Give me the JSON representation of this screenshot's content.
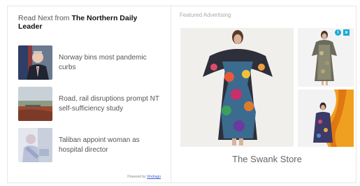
{
  "recirculation": {
    "header_prefix": "Read Next from ",
    "header_brand": "The Northern Daily Leader",
    "articles": [
      {
        "title": "Norway bins most pandemic curbs",
        "thumb_icon": "news-photo-politician"
      },
      {
        "title": "Road, rail disruptions prompt NT self-sufficiency study",
        "thumb_icon": "news-photo-landscape"
      },
      {
        "title": "Taliban appoint woman as hospital director",
        "thumb_icon": "news-photo-hospital"
      }
    ],
    "powered_prefix": "Powered by ",
    "powered_link": "Vindrago"
  },
  "ad": {
    "label": "Featured Advertising",
    "info_icon": "info-icon",
    "close_icon": "close-icon",
    "info_glyph": "i",
    "close_glyph": "×",
    "store_name": "The Swank Store"
  },
  "colors": {
    "ad_badge": "#19a9d6",
    "link": "#3a5bd1"
  }
}
